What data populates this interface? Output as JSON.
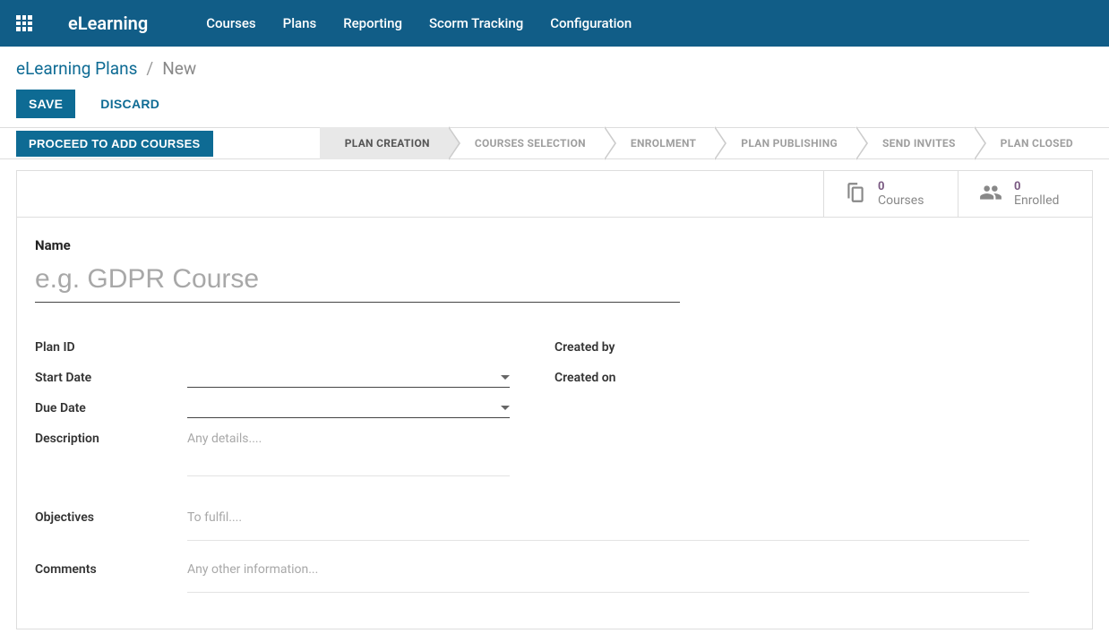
{
  "navbar": {
    "brand": "eLearning",
    "items": [
      "Courses",
      "Plans",
      "Reporting",
      "Scorm Tracking",
      "Configuration"
    ]
  },
  "breadcrumb": {
    "root": "eLearning Plans",
    "sep": "/",
    "current": "New"
  },
  "actions": {
    "save": "SAVE",
    "discard": "DISCARD"
  },
  "status": {
    "proceed": "PROCEED TO ADD COURSES",
    "stages": [
      "PLAN CREATION",
      "COURSES SELECTION",
      "ENROLMENT",
      "PLAN PUBLISHING",
      "SEND INVITES",
      "PLAN CLOSED"
    ],
    "active_index": 0
  },
  "stats": {
    "courses": {
      "count": "0",
      "label": "Courses"
    },
    "enrolled": {
      "count": "0",
      "label": "Enrolled"
    }
  },
  "form": {
    "name_label": "Name",
    "name_placeholder": "e.g. GDPR Course",
    "plan_id_label": "Plan ID",
    "start_date_label": "Start Date",
    "due_date_label": "Due Date",
    "description_label": "Description",
    "description_placeholder": "Any details....",
    "objectives_label": "Objectives",
    "objectives_placeholder": "To fulfil....",
    "comments_label": "Comments",
    "comments_placeholder": "Any other information...",
    "created_by_label": "Created by",
    "created_on_label": "Created on"
  }
}
